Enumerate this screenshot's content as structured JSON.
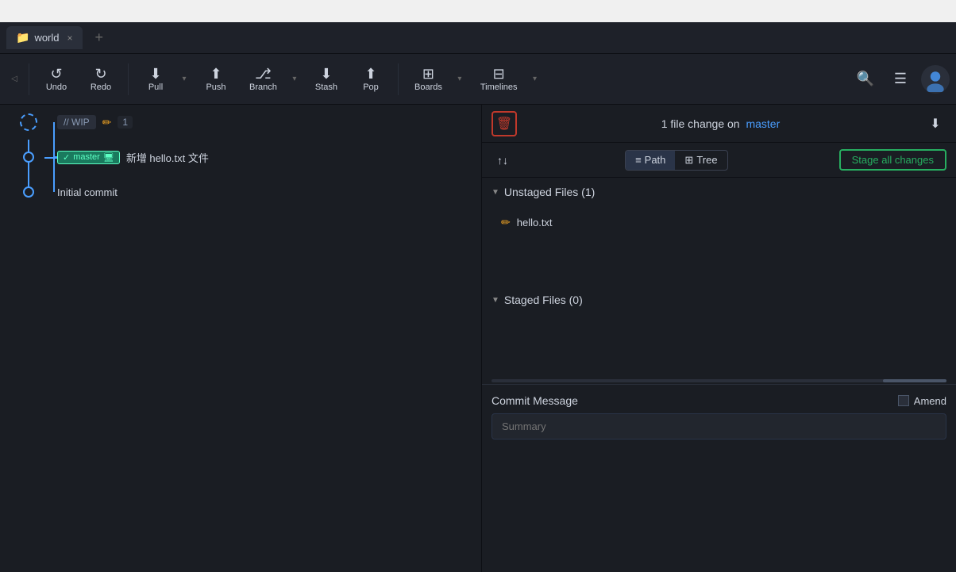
{
  "titlebar": {
    "bg": "#f0f0f0"
  },
  "tabbar": {
    "tab": {
      "icon": "📁",
      "label": "world",
      "close": "×"
    },
    "add": "+"
  },
  "toolbar": {
    "left_arrow": "◁",
    "undo_label": "Undo",
    "undo_icon": "↺",
    "redo_label": "Redo",
    "redo_icon": "↻",
    "pull_label": "Pull",
    "pull_icon": "⬇",
    "push_label": "Push",
    "push_icon": "⬆",
    "branch_label": "Branch",
    "branch_icon": "⎇",
    "stash_label": "Stash",
    "stash_icon": "📥",
    "pop_label": "Pop",
    "pop_icon": "📤",
    "boards_label": "Boards",
    "boards_icon": "⊞",
    "timelines_label": "Timelines",
    "timelines_icon": "⊟",
    "search_icon": "🔍",
    "menu_icon": "☰"
  },
  "graph": {
    "wip": {
      "label": "// WIP",
      "count": "1"
    },
    "commits": [
      {
        "message": "新增 hello.txt 文件",
        "branch": "master",
        "branch_icon": "🖥"
      },
      {
        "message": "Initial commit"
      }
    ]
  },
  "right_panel": {
    "discard_icon": "🗑",
    "change_info": "1 file change on",
    "branch_name": "master",
    "download_icon": "⬇",
    "sort_icon": "↕",
    "view_path": "Path",
    "view_path_icon": "≡",
    "view_tree": "Tree",
    "view_tree_icon": "⊞",
    "unstaged_label": "Unstaged Files (1)",
    "stage_all_label": "Stage all changes",
    "file_icon": "✏",
    "file_name": "hello.txt",
    "staged_label": "Staged Files (0)",
    "commit_msg_label": "Commit Message",
    "amend_label": "Amend",
    "summary_placeholder": "Summary"
  }
}
